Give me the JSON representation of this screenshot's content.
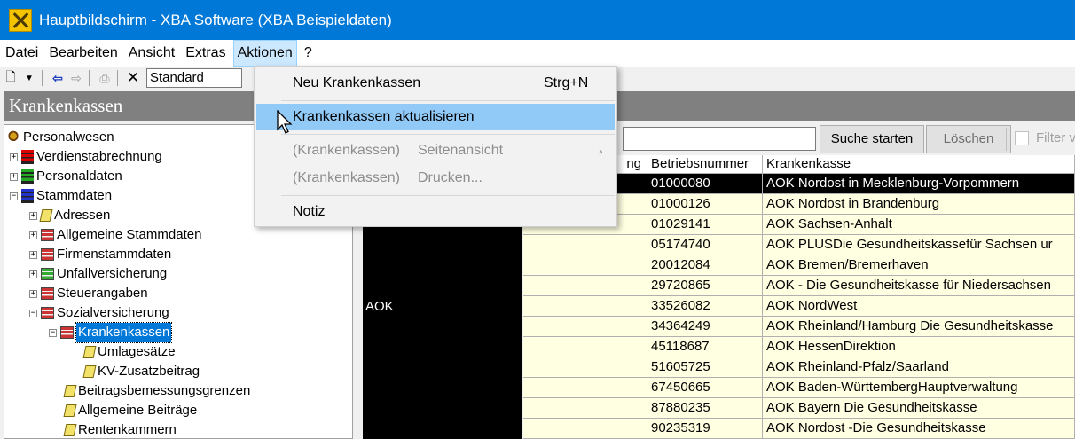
{
  "window": {
    "title": "Hauptbildschirm - XBA Software (XBA Beispieldaten)"
  },
  "menubar": {
    "items": [
      "Datei",
      "Bearbeiten",
      "Ansicht",
      "Extras",
      "Aktionen",
      "?"
    ]
  },
  "toolbar": {
    "view_select_value": "Standard"
  },
  "section": {
    "title": "Krankenkassen"
  },
  "tree": {
    "root": "Personalwesen",
    "verdienst": "Verdienstabrechnung",
    "personaldaten": "Personaldaten",
    "stammdaten": "Stammdaten",
    "adressen": "Adressen",
    "allgemeine_stammdaten": "Allgemeine Stammdaten",
    "firmenstammdaten": "Firmenstammdaten",
    "unfallversicherung": "Unfallversicherung",
    "steuerangaben": "Steuerangaben",
    "sozialversicherung": "Sozialversicherung",
    "krankenkassen": "Krankenkassen",
    "umlagesaetze": "Umlagesätze",
    "kv_zusatzbeitrag": "KV-Zusatzbeitrag",
    "beitragsbemessungsgrenzen": "Beitragsbemessungsgrenzen",
    "allgemeine_beitraege": "Allgemeine Beiträge",
    "rentenkammern": "Rentenkammern"
  },
  "grid": {
    "search_button": "Suche starten",
    "reset_button": "Löschen",
    "filter_label": "Filter v",
    "group_value": "AOK",
    "columns": [
      "ng",
      "Betriebsnummer",
      "Krankenkasse"
    ],
    "rows": [
      {
        "betriebsnummer": "01000080",
        "krankenkasse": "AOK Nordost in Mecklenburg-Vorpommern"
      },
      {
        "betriebsnummer": "01000126",
        "krankenkasse": "AOK Nordost in Brandenburg"
      },
      {
        "betriebsnummer": "01029141",
        "krankenkasse": "AOK Sachsen-Anhalt"
      },
      {
        "betriebsnummer": "05174740",
        "krankenkasse": "AOK PLUSDie Gesundheitskassefür Sachsen ur"
      },
      {
        "betriebsnummer": "20012084",
        "krankenkasse": "AOK Bremen/Bremerhaven"
      },
      {
        "betriebsnummer": "29720865",
        "krankenkasse": "AOK - Die Gesundheitskasse für Niedersachsen"
      },
      {
        "betriebsnummer": "33526082",
        "krankenkasse": "AOK NordWest"
      },
      {
        "betriebsnummer": "34364249",
        "krankenkasse": "AOK Rheinland/Hamburg Die Gesundheitskasse"
      },
      {
        "betriebsnummer": "45118687",
        "krankenkasse": "AOK HessenDirektion"
      },
      {
        "betriebsnummer": "51605725",
        "krankenkasse": "AOK Rheinland-Pfalz/Saarland"
      },
      {
        "betriebsnummer": "67450665",
        "krankenkasse": "AOK Baden-WürttembergHauptverwaltung"
      },
      {
        "betriebsnummer": "87880235",
        "krankenkasse": "AOK Bayern Die Gesundheitskasse"
      },
      {
        "betriebsnummer": "90235319",
        "krankenkasse": "AOK Nordost -Die Gesundheitskasse"
      }
    ]
  },
  "dropdown": {
    "neu_label": "Neu Krankenkassen",
    "neu_shortcut": "Strg+N",
    "aktualisieren_label": "Krankenkassen aktualisieren",
    "seitenansicht_prefix": "(Krankenkassen)",
    "seitenansicht_label": "Seitenansicht",
    "drucken_prefix": "(Krankenkassen)",
    "drucken_label": "Drucken...",
    "notiz_label": "Notiz"
  },
  "colors": {
    "titlebar": "#0078d7",
    "selection": "#0078d7",
    "highlight": "#91c9f7",
    "grid_cell": "#ffffe1"
  }
}
